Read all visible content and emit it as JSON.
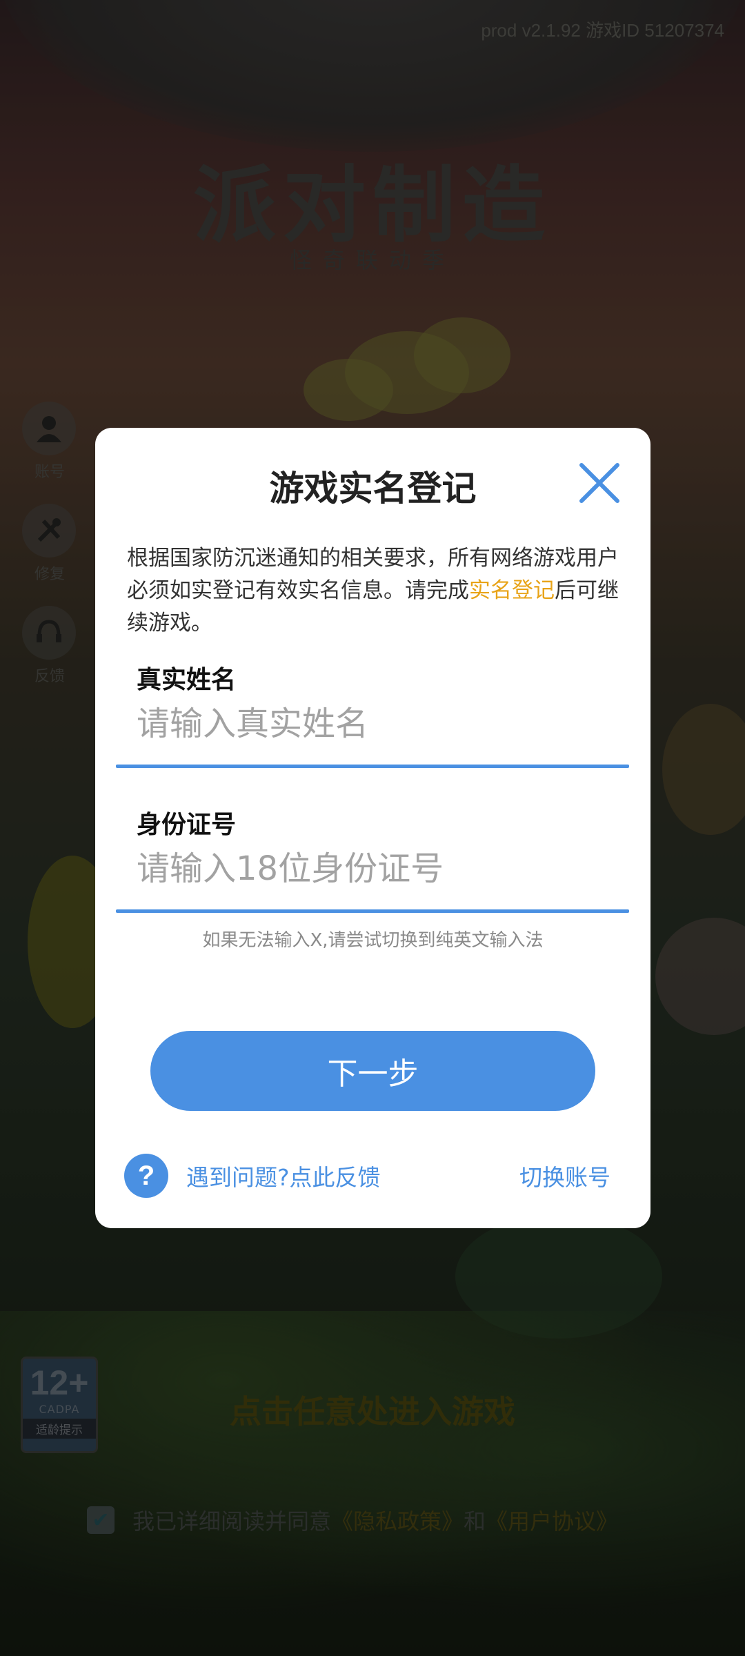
{
  "background": {
    "version_text": "prod v2.1.92 游戏ID 51207374",
    "logo_title": "派对制造",
    "logo_subtitle": "怪奇联动季",
    "side_buttons": [
      {
        "icon": "person-icon",
        "label": "账号"
      },
      {
        "icon": "tools-icon",
        "label": "修复"
      },
      {
        "icon": "headset-icon",
        "label": "反馈"
      }
    ],
    "age_badge": {
      "rating": "12+",
      "org": "CADPA",
      "tip": "适龄提示"
    },
    "enter_hint": "点击任意处进入游戏",
    "agreement": {
      "checked": true,
      "prefix": "我已详细阅读并同意",
      "privacy_link": "《隐私政策》",
      "and_text": "和",
      "terms_link": "《用户协议》"
    }
  },
  "dialog": {
    "title": "游戏实名登记",
    "notice_before": "根据国家防沉迷通知的相关要求，所有网络游戏用户必须如实登记有效实名信息。请完成",
    "notice_highlight": "实名登记",
    "notice_after": "后可继续游戏。",
    "name_field": {
      "label": "真实姓名",
      "placeholder": "请输入真实姓名",
      "value": ""
    },
    "id_field": {
      "label": "身份证号",
      "placeholder": "请输入18位身份证号",
      "value": ""
    },
    "input_hint": "如果无法输入X,请尝试切换到纯英文输入法",
    "next_button": "下一步",
    "help_icon": "?",
    "help_text": "遇到问题?点此反馈",
    "switch_account": "切换账号",
    "accent_color": "#4a90e2",
    "highlight_color": "#e8a317"
  }
}
